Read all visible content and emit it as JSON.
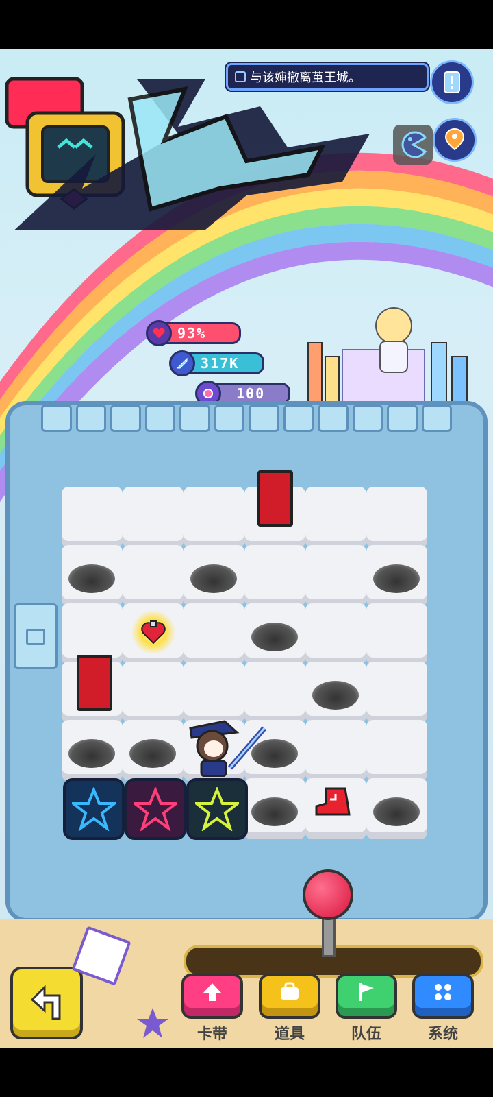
{
  "quest": {
    "text": "与该婶撤离茧王城。"
  },
  "stats": {
    "hp": "93%",
    "attack": "317K",
    "gems": "100"
  },
  "nav": [
    {
      "label": "卡带",
      "icon": "up-arrow-icon",
      "color": "#ff3e83"
    },
    {
      "label": "道具",
      "icon": "bag-icon",
      "color": "#f5c21b"
    },
    {
      "label": "队伍",
      "icon": "flag-icon",
      "color": "#3fd06f"
    },
    {
      "label": "系统",
      "icon": "grid-icon",
      "color": "#2f8bff"
    }
  ],
  "colors": {
    "hp": "#ff4f6e",
    "attack": "#3ac0d6",
    "gems": "#8a7cc8"
  }
}
